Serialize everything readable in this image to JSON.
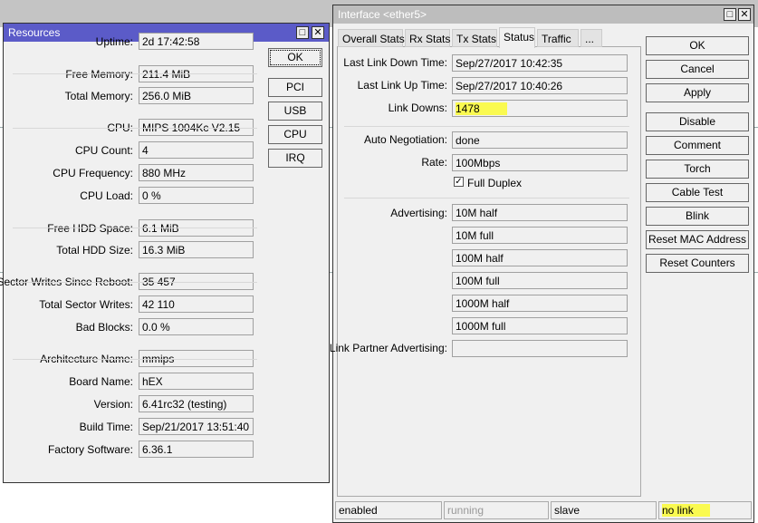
{
  "resources": {
    "title": "Resources",
    "rows": [
      {
        "label": "Uptime:",
        "value": "2d 17:42:58"
      },
      {
        "label": "Free Memory:",
        "value": "211.4 MiB"
      },
      {
        "label": "Total Memory:",
        "value": "256.0 MiB"
      },
      {
        "label": "CPU:",
        "value": "MIPS 1004Kc V2.15"
      },
      {
        "label": "CPU Count:",
        "value": "4"
      },
      {
        "label": "CPU Frequency:",
        "value": "880 MHz"
      },
      {
        "label": "CPU Load:",
        "value": "0 %"
      },
      {
        "label": "Free HDD Space:",
        "value": "6.1 MiB"
      },
      {
        "label": "Total HDD Size:",
        "value": "16.3 MiB"
      },
      {
        "label": "Sector Writes Since Reboot:",
        "value": "35 457"
      },
      {
        "label": "Total Sector Writes:",
        "value": "42 110"
      },
      {
        "label": "Bad Blocks:",
        "value": "0.0 %"
      },
      {
        "label": "Architecture Name:",
        "value": "mmips"
      },
      {
        "label": "Board Name:",
        "value": "hEX"
      },
      {
        "label": "Version:",
        "value": "6.41rc32 (testing)"
      },
      {
        "label": "Build Time:",
        "value": "Sep/21/2017 13:51:40"
      },
      {
        "label": "Factory Software:",
        "value": "6.36.1"
      }
    ],
    "buttons": [
      "OK",
      "PCI",
      "USB",
      "CPU",
      "IRQ"
    ]
  },
  "interface": {
    "title": "Interface <ether5>",
    "tabs": [
      "Overall Stats",
      "Rx Stats",
      "Tx Stats",
      "Status",
      "Traffic",
      "..."
    ],
    "active_tab": "Status",
    "last_link_down_label": "Last Link Down Time:",
    "last_link_down": "Sep/27/2017 10:42:35",
    "last_link_up_label": "Last Link Up Time:",
    "last_link_up": "Sep/27/2017 10:40:26",
    "link_downs_label": "Link Downs:",
    "link_downs": "1478",
    "auto_neg_label": "Auto Negotiation:",
    "auto_neg": "done",
    "rate_label": "Rate:",
    "rate": "100Mbps",
    "full_duplex_label": "Full Duplex",
    "full_duplex": true,
    "advertising_label": "Advertising:",
    "advertising": [
      "10M half",
      "10M full",
      "100M half",
      "100M full",
      "1000M half",
      "1000M full"
    ],
    "partner_label": "Link Partner Advertising:",
    "partner": "",
    "buttons": [
      "OK",
      "Cancel",
      "Apply",
      "Disable",
      "Comment",
      "Torch",
      "Cable Test",
      "Blink",
      "Reset MAC Address",
      "Reset Counters"
    ],
    "status": [
      "enabled",
      "running",
      "slave",
      "no link"
    ]
  },
  "colors": {
    "active_title": "#5b5bc8",
    "inactive_title": "#bdbdbd",
    "highlight": "#fafa50"
  }
}
